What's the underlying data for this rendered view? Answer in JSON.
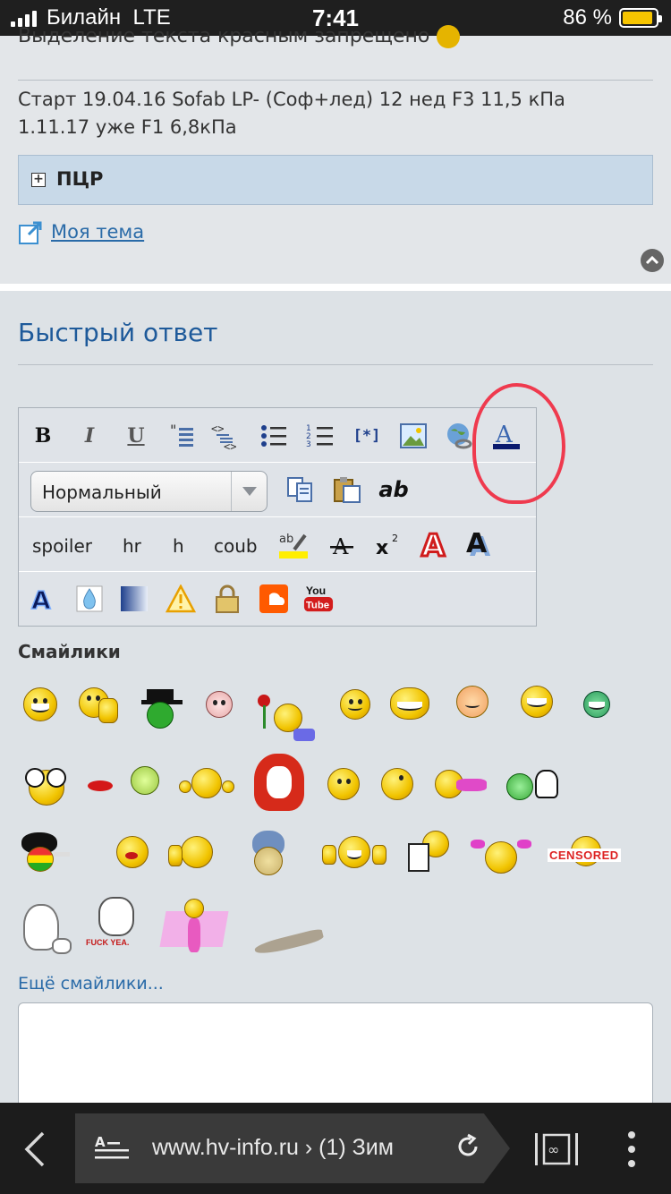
{
  "status_bar": {
    "carrier": "Билайн",
    "network": "LTE",
    "time": "7:41",
    "battery": "86 %",
    "battery_level": 0.86,
    "battery_color": "#f7c500"
  },
  "post": {
    "cut_text": "Выделение текста красным запрещено",
    "signature_line1": "Старт 19.04.16 Sofab LP- (Соф+лед) 12 нед F3 11,5 кПа",
    "signature_line2": "1.11.17 уже F1 6,8кПа",
    "spoiler_title": "ПЦР",
    "my_topic_link": "Моя тема"
  },
  "quick_reply": {
    "title": "Быстрый ответ",
    "format_select": "Нормальный",
    "toolbar_row1_icons": [
      "bold-icon",
      "italic-icon",
      "underline-icon",
      "quote-icon",
      "code-icon",
      "bullet-list-icon",
      "numbered-list-icon",
      "list-item-icon",
      "image-icon",
      "link-icon",
      "font-color-icon"
    ],
    "toolbar_row2_icons": [
      "copy-icon",
      "paste-icon",
      "remove-format-icon"
    ],
    "text_buttons": {
      "spoiler": "spoiler",
      "hr": "hr",
      "h": "h",
      "coub": "coub"
    },
    "bold_glyph": "B",
    "italic_glyph": "I",
    "underline_glyph": "U",
    "list_item_glyph": "[*]",
    "font_color_glyph": "A",
    "ab_glyph": "ab",
    "superscript_glyph": "x",
    "superscript_small": "2",
    "youtube_top": "You",
    "youtube_bottom": "Tube",
    "highlight_color": "#ef3a4e"
  },
  "smilies": {
    "title": "Смайлики",
    "censored_label": "CENSORED",
    "fuck_yea_label": "FUCK YEA.",
    "more_link": "Ещё смайлики..."
  },
  "browser": {
    "url": "www.hv-info.ru › (1) Зим",
    "reader_icon": "reader-mode-icon",
    "tabs_icon": "tabs-icon"
  }
}
